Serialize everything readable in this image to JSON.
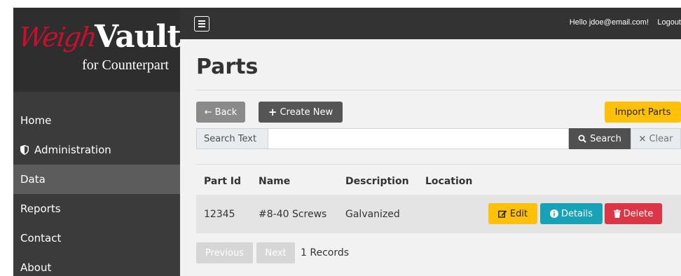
{
  "app": {
    "logo_main_1": "Weigh",
    "logo_main_2": "Vault",
    "logo_sub": "for Counterpart"
  },
  "topbar": {
    "greeting": "Hello jdoe@email.com!",
    "logout": "Logout"
  },
  "sidebar": {
    "items": [
      {
        "label": "Home",
        "icon": ""
      },
      {
        "label": "Administration",
        "icon": "shield-icon"
      },
      {
        "label": "Data",
        "icon": ""
      },
      {
        "label": "Reports",
        "icon": ""
      },
      {
        "label": "Contact",
        "icon": ""
      },
      {
        "label": "About",
        "icon": ""
      }
    ],
    "active": "Data"
  },
  "page": {
    "title": "Parts"
  },
  "toolbar": {
    "back_label": "Back",
    "create_label": "Create New",
    "import_label": "Import Parts"
  },
  "search": {
    "prefix": "Search Text",
    "value": "",
    "button_label": "Search",
    "clear_label": "Clear"
  },
  "table": {
    "columns": [
      "Part Id",
      "Name",
      "Description",
      "Location"
    ],
    "rows": [
      {
        "part_id": "12345",
        "name": "#8-40 Screws",
        "description": "Galvanized",
        "location": ""
      }
    ],
    "actions": {
      "edit": "Edit",
      "details": "Details",
      "delete": "Delete"
    }
  },
  "pager": {
    "previous": "Previous",
    "next": "Next",
    "records": "1 Records"
  },
  "colors": {
    "sidebar": "#3b3b3b",
    "topbar": "#333333",
    "warning": "#ffc107",
    "info": "#17a2b8",
    "danger": "#dc3545",
    "brand_red": "#c8102e"
  }
}
